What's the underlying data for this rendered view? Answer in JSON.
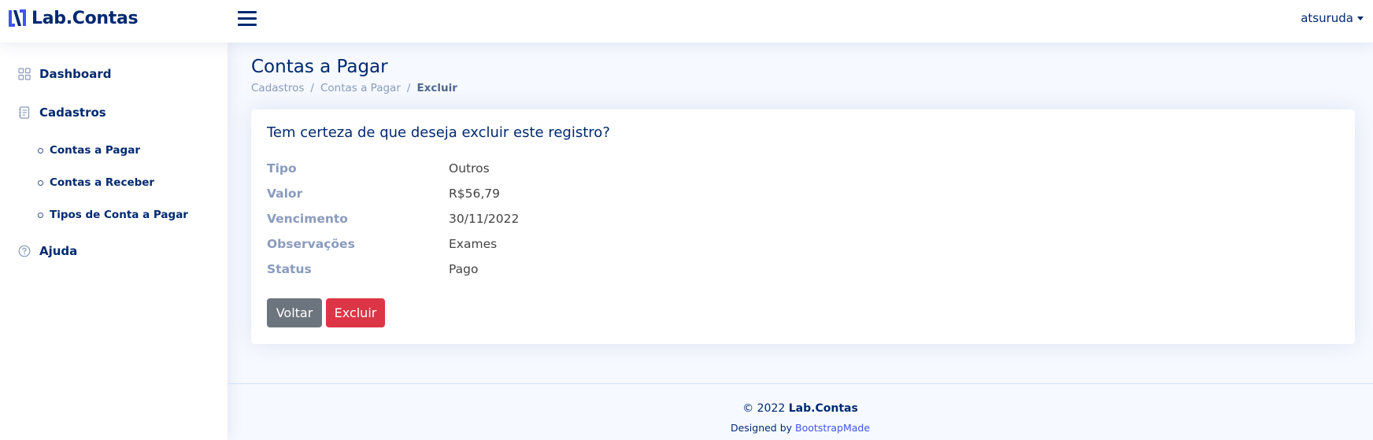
{
  "header": {
    "brand": "Lab.Contas",
    "user": "atsuruda"
  },
  "sidebar": {
    "items": [
      {
        "label": "Dashboard",
        "icon": "grid-icon"
      },
      {
        "label": "Cadastros",
        "icon": "journal-text-icon"
      },
      {
        "label": "Ajuda",
        "icon": "question-circle-icon"
      }
    ],
    "subitems": [
      {
        "label": "Contas a Pagar"
      },
      {
        "label": "Contas a Receber"
      },
      {
        "label": "Tipos de Conta a Pagar"
      }
    ]
  },
  "main": {
    "title": "Contas a Pagar",
    "breadcrumb": [
      "Cadastros",
      "Contas a Pagar",
      "Excluir"
    ],
    "breadcrumb_separator": "/",
    "card": {
      "title": "Tem certeza de que deseja excluir este registro?",
      "details": [
        {
          "label": "Tipo",
          "value": "Outros"
        },
        {
          "label": "Valor",
          "value": "R$56,79"
        },
        {
          "label": "Vencimento",
          "value": "30/11/2022"
        },
        {
          "label": "Observações",
          "value": "Exames"
        },
        {
          "label": "Status",
          "value": "Pago"
        }
      ],
      "buttons": {
        "back": "Voltar",
        "delete": "Excluir"
      }
    }
  },
  "footer": {
    "copyright_prefix": "© 2022",
    "copyright_brand": "Lab.Contas",
    "credits_prefix": "Designed by",
    "credits_link": "BootstrapMade"
  },
  "colors": {
    "primary": "#012970",
    "accent": "#4154f1",
    "background": "#f6f9ff",
    "secondary_button": "#6c757d",
    "danger_button": "#dc3545",
    "muted_label": "#899bbd"
  }
}
